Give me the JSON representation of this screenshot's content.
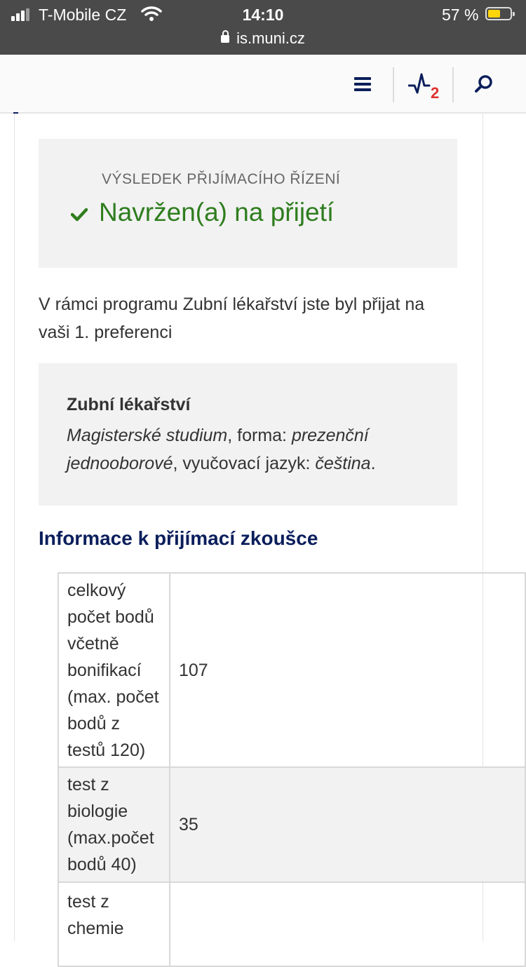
{
  "status_bar": {
    "carrier": "T-Mobile CZ",
    "time": "14:10",
    "battery": "57 %",
    "url": "is.muni.cz"
  },
  "topbar": {
    "notification_count": "2"
  },
  "result": {
    "label": "VÝSLEDEK PŘIJÍMACÍHO ŘÍZENÍ",
    "status": "Navržen(a) na přijetí",
    "status_color": "#2f7d1f"
  },
  "intro": "V rámci programu Zubní lékařství jste byl přijat na vaši 1. preferenci",
  "program": {
    "title": "Zubní lékařství",
    "type": "Magisterské studium",
    "form_label": ", forma: ",
    "form_value": "prezenční jednooborové",
    "language_label": ", vyučovací jazyk: ",
    "language_value": "čeština",
    "end": "."
  },
  "section_heading": "Informace k přijímací zkoušce",
  "table": {
    "rows": [
      {
        "label": "celkový počet bodů včetně bonifikací (max. počet bodů z testů 120)",
        "value": "107"
      },
      {
        "label": "test z biologie (max.počet bodů 40)",
        "value": "35"
      },
      {
        "label": "test z chemie",
        "value": ""
      }
    ]
  },
  "colors": {
    "brand_navy": "#0b1e5b",
    "badge_red": "#e03131"
  }
}
